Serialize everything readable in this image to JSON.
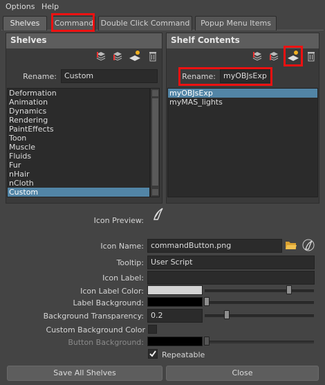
{
  "menu": {
    "options": "Options",
    "help": "Help"
  },
  "tabs": [
    {
      "label": "Shelves"
    },
    {
      "label": "Command"
    },
    {
      "label": "Double Click Command"
    },
    {
      "label": "Popup Menu Items"
    }
  ],
  "shelves": {
    "title": "Shelves",
    "rename_label": "Rename:",
    "rename_value": "Custom",
    "items": [
      "Deformation",
      "Animation",
      "Dynamics",
      "Rendering",
      "PaintEffects",
      "Toon",
      "Muscle",
      "Fluids",
      "Fur",
      "nHair",
      "nCloth",
      "Custom"
    ],
    "selected": "Custom"
  },
  "shelf_contents": {
    "title": "Shelf Contents",
    "rename_label": "Rename:",
    "rename_value": "myOBJsExp",
    "items": [
      "myOBJsExp",
      "myMAS_lights"
    ],
    "selected": "myOBJsExp"
  },
  "form": {
    "icon_preview_label": "Icon Preview:",
    "icon_name_label": "Icon Name:",
    "icon_name_value": "commandButton.png",
    "tooltip_label": "Tooltip:",
    "tooltip_value": "User Script",
    "icon_label_label": "Icon Label:",
    "icon_label_value": "",
    "icon_label_color_label": "Icon Label Color:",
    "label_background_label": "Label Background:",
    "background_transparency_label": "Background Transparency:",
    "background_transparency_value": "0.2",
    "custom_background_color_label": "Custom Background Color",
    "button_background_label": "Button Background:",
    "repeatable_label": "Repeatable",
    "repeatable_checked": true
  },
  "buttons": {
    "save_all": "Save All Shelves",
    "close": "Close"
  },
  "colors": {
    "highlight": "#ee1111",
    "selection": "#5285a6"
  }
}
